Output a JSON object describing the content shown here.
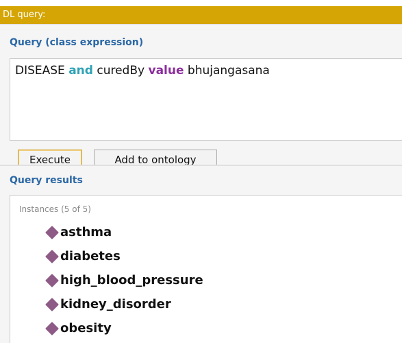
{
  "window": {
    "title": "DL query:"
  },
  "query": {
    "label": "Query (class expression)",
    "expression": [
      {
        "text": "DISEASE ",
        "style": "plain"
      },
      {
        "text": "and",
        "style": "keyword-and"
      },
      {
        "text": " curedBy ",
        "style": "plain"
      },
      {
        "text": "value",
        "style": "keyword-value"
      },
      {
        "text": " bhujangasana",
        "style": "plain"
      }
    ]
  },
  "buttons": {
    "execute_label": "Execute",
    "add_label": "Add to ontology"
  },
  "results": {
    "label": "Query results",
    "instances_header": "Instances (5 of 5)",
    "items": [
      {
        "name": "asthma",
        "icon": "individual-diamond-icon"
      },
      {
        "name": "diabetes",
        "icon": "individual-diamond-icon"
      },
      {
        "name": "high_blood_pressure",
        "icon": "individual-diamond-icon"
      },
      {
        "name": "kidney_disorder",
        "icon": "individual-diamond-icon"
      },
      {
        "name": "obesity",
        "icon": "individual-diamond-icon"
      }
    ]
  },
  "colors": {
    "title_bar": "#d4a505",
    "section_label": "#2a67a6",
    "keyword_and": "#2fa2b5",
    "keyword_value": "#8b2d9c",
    "individual_icon": "#8e5a86"
  }
}
